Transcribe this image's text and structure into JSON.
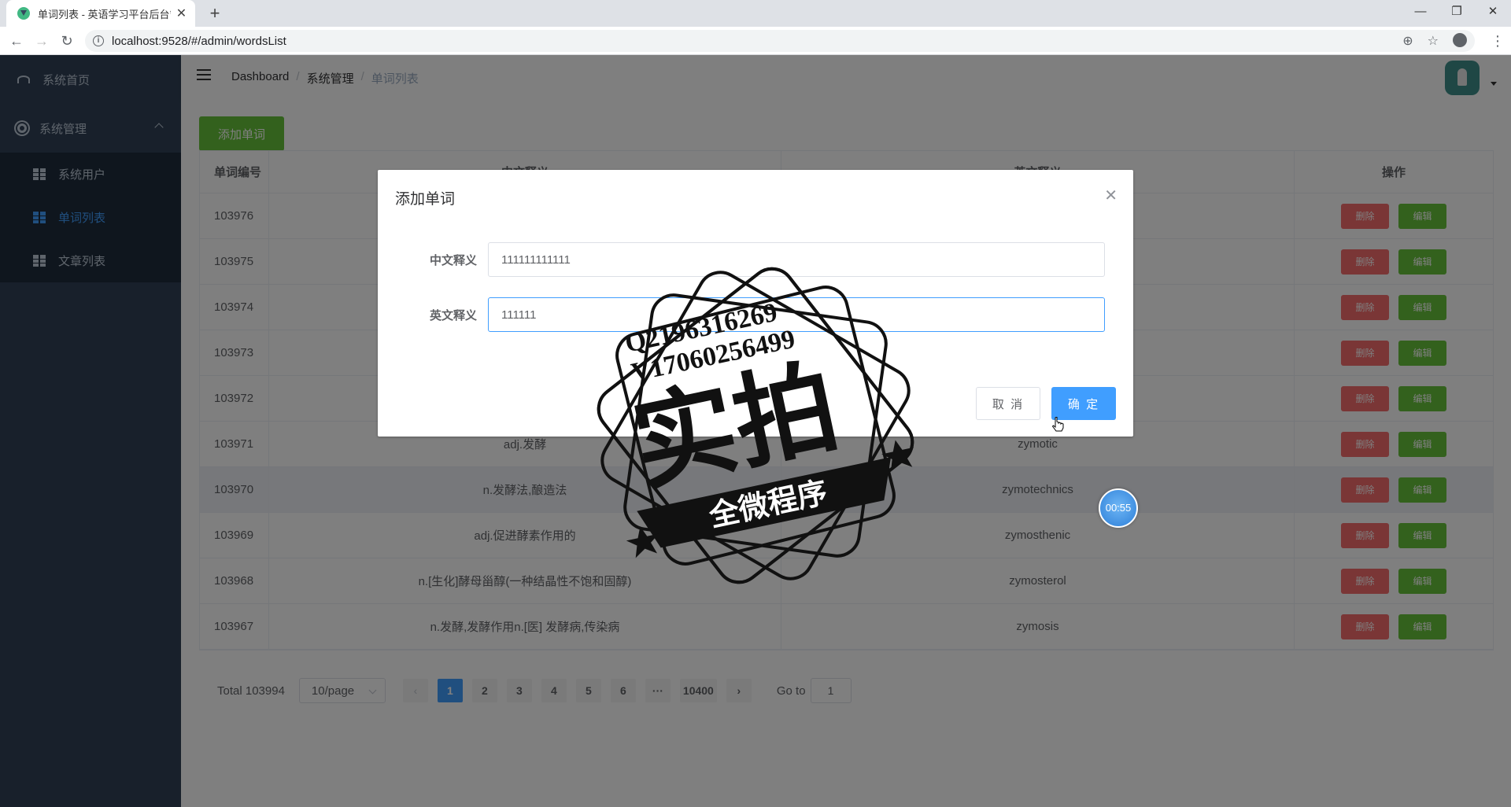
{
  "browser": {
    "tab_title": "单词列表 - 英语学习平台后台管理",
    "tab_close": "✕",
    "new_tab": "+",
    "url": "localhost:9528/#/admin/wordsList",
    "win_min": "—",
    "win_restore": "❐",
    "win_close": "✕"
  },
  "sidebar": {
    "items": [
      {
        "label": "系统首页"
      },
      {
        "label": "系统管理"
      }
    ],
    "sub_items": [
      {
        "label": "系统用户"
      },
      {
        "label": "单词列表"
      },
      {
        "label": "文章列表"
      }
    ]
  },
  "breadcrumb": {
    "items": [
      "Dashboard",
      "系统管理",
      "单词列表"
    ],
    "sep": "/"
  },
  "toolbar": {
    "add_label": "添加单词"
  },
  "table": {
    "headers": [
      "单词编号",
      "中文释义",
      "英文释义",
      "操作"
    ],
    "delete_label": "删除",
    "edit_label": "编辑",
    "rows": [
      {
        "id": "103976",
        "cn": "",
        "en": ""
      },
      {
        "id": "103975",
        "cn": "",
        "en": ""
      },
      {
        "id": "103974",
        "cn": "",
        "en": ""
      },
      {
        "id": "103973",
        "cn": "",
        "en": ""
      },
      {
        "id": "103972",
        "cn": "",
        "en": ""
      },
      {
        "id": "103971",
        "cn": "adj.发酵",
        "en": "zymotic"
      },
      {
        "id": "103970",
        "cn": "n.发酵法,酿造法",
        "en": "zymotechnics"
      },
      {
        "id": "103969",
        "cn": "adj.促进酵素作用的",
        "en": "zymosthenic"
      },
      {
        "id": "103968",
        "cn": "n.[生化]酵母甾醇(一种结晶性不饱和固醇)",
        "en": "zymosterol"
      },
      {
        "id": "103967",
        "cn": "n.发酵,发酵作用n.[医] 发酵病,传染病",
        "en": "zymosis"
      }
    ]
  },
  "pagination": {
    "total": "Total 103994",
    "page_size": "10/page",
    "prev": "‹",
    "next": "›",
    "pages": [
      "1",
      "2",
      "3",
      "4",
      "5",
      "6",
      "···",
      "10400"
    ],
    "current": "1",
    "goto_label": "Go to",
    "goto_value": "1"
  },
  "dialog": {
    "title": "添加单词",
    "close": "✕",
    "cn_label": "中文释义",
    "cn_value": "111111111111",
    "en_label": "英文释义",
    "en_value": "111111",
    "cancel_label": "取 消",
    "ok_label": "确 定"
  },
  "timer": {
    "text": "00:55"
  },
  "watermark": {
    "line1": "Q2196316269",
    "line2": "V17060256499",
    "big": "实拍",
    "banner": "全微程序"
  },
  "colors": {
    "sidebar_bg": "#304156",
    "primary": "#409eff",
    "success": "#67c23a",
    "danger": "#f56c6c"
  }
}
